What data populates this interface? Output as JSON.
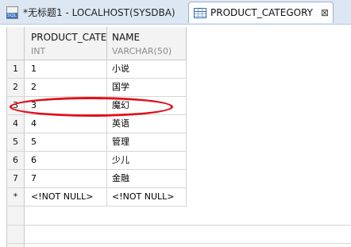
{
  "tabs": [
    {
      "label": "*无标题1 - LOCALHOST(SYSDBA)",
      "icon": "sql-file-icon",
      "icon_text": "SQL",
      "active": false
    },
    {
      "label": "PRODUCT_CATEGORY",
      "icon": "table-icon",
      "active": true,
      "close": "⊠"
    }
  ],
  "columns": [
    {
      "name": "PRODUCT_CATE",
      "type": "INT"
    },
    {
      "name": "NAME",
      "type": "VARCHAR(50)"
    }
  ],
  "rows": [
    {
      "n": "1",
      "id": "1",
      "name": "小说"
    },
    {
      "n": "2",
      "id": "2",
      "name": "国学"
    },
    {
      "n": "3",
      "id": "3",
      "name": "魔幻"
    },
    {
      "n": "4",
      "id": "4",
      "name": "英语"
    },
    {
      "n": "5",
      "id": "5",
      "name": "管理"
    },
    {
      "n": "6",
      "id": "6",
      "name": "少儿"
    },
    {
      "n": "7",
      "id": "7",
      "name": "金融"
    }
  ],
  "new_row": {
    "n": "*",
    "id": "<!NOT NULL>",
    "name": "<!NOT NULL>"
  },
  "annotation_color": "#e0101a"
}
